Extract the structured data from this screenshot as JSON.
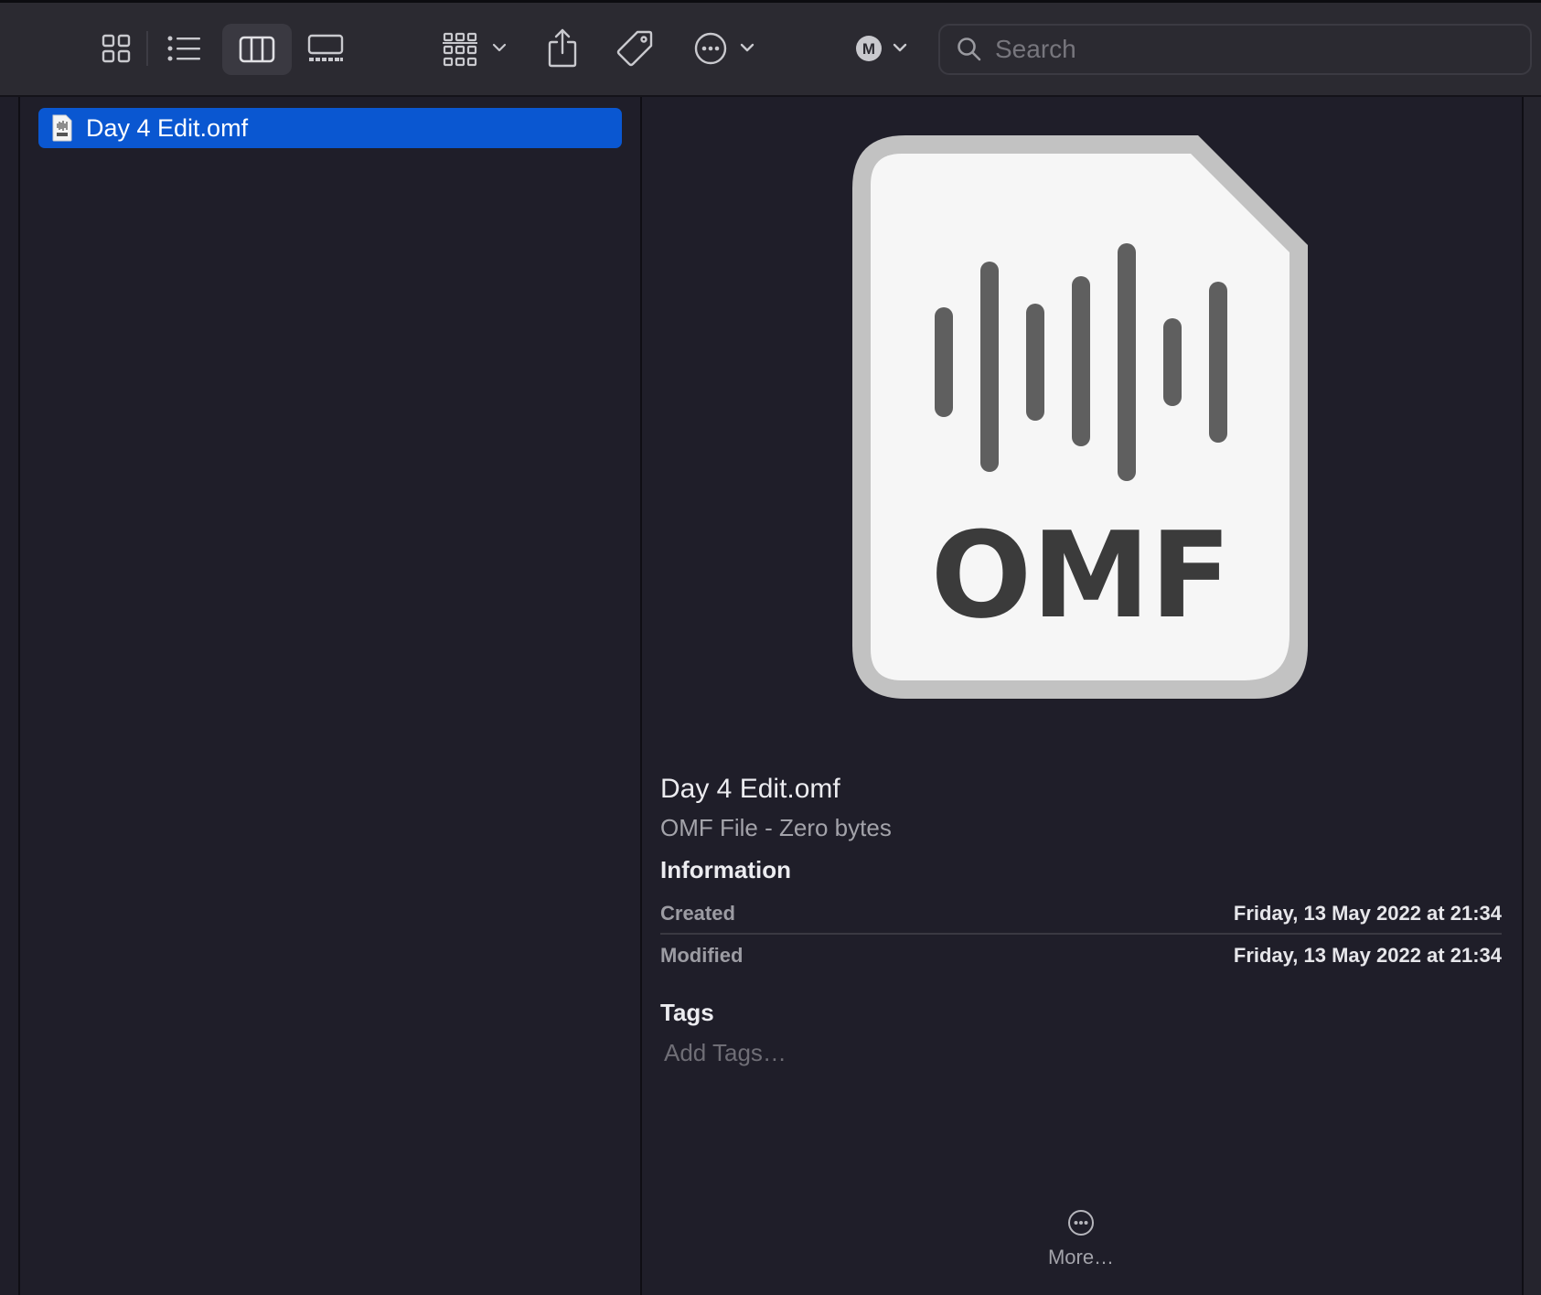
{
  "toolbar": {
    "search_placeholder": "Search",
    "icons": [
      "icon-view-icon",
      "list-view-icon",
      "column-view-icon",
      "gallery-view-icon",
      "group-icon",
      "share-icon",
      "tag-icon",
      "more-actions-icon",
      "account-icon"
    ],
    "account_initial": "M"
  },
  "column": {
    "selected_item": "Day 4 Edit.omf"
  },
  "preview": {
    "icon_text": "OMF",
    "file_name": "Day 4 Edit.omf",
    "file_kind": "OMF File - Zero bytes",
    "information_title": "Information",
    "info": [
      {
        "label": "Created",
        "value": "Friday, 13 May 2022 at 21:34"
      },
      {
        "label": "Modified",
        "value": "Friday, 13 May 2022 at 21:34"
      }
    ],
    "tags_title": "Tags",
    "tags_placeholder": "Add Tags…",
    "more_label": "More…"
  },
  "colors": {
    "selection": "#0a57d1",
    "background": "#1f1e29",
    "toolbar": "#2b2a31"
  }
}
